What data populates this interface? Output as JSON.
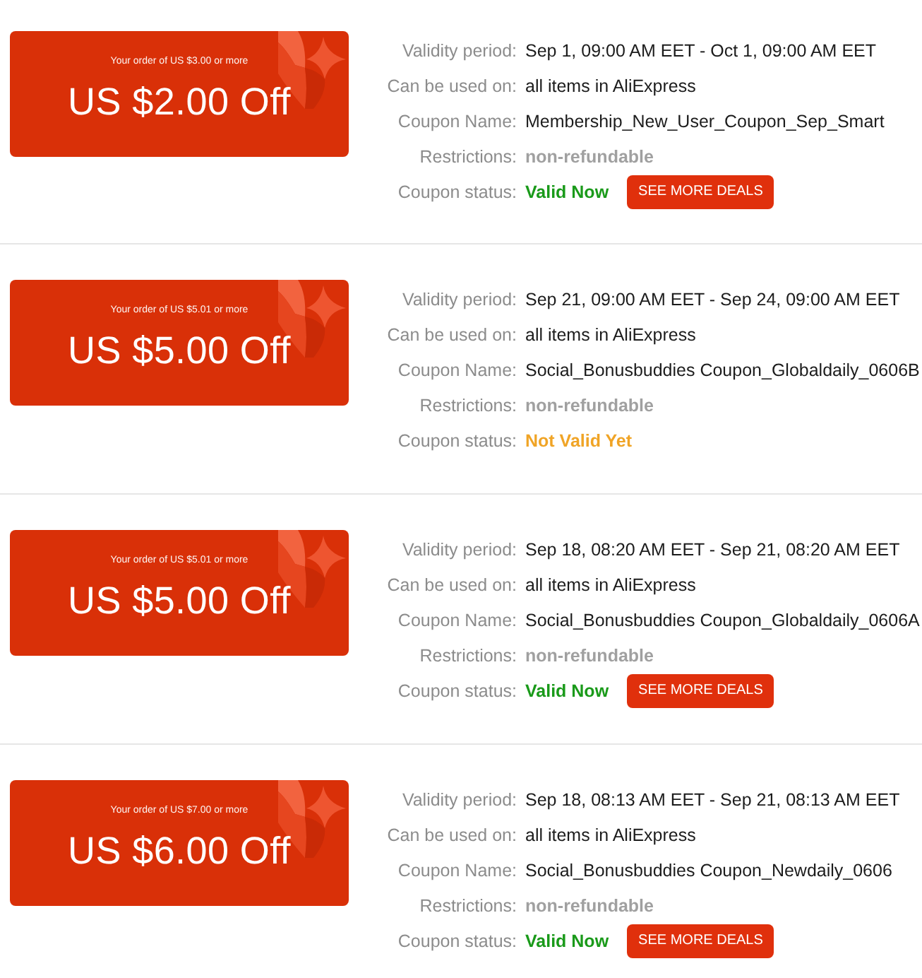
{
  "coupons": [
    {
      "card": {
        "condition": "Your order of US $3.00 or more",
        "amount": "US $2.00 Off"
      },
      "details": [
        {
          "label": "Validity period:",
          "value": "Sep 1, 09:00 AM EET - Oct 1, 09:00 AM EET",
          "kind": "plain"
        },
        {
          "label": "Can be used on:",
          "value": "all items in AliExpress",
          "kind": "plain"
        },
        {
          "label": "Coupon Name:",
          "value": "Membership_New_User_Coupon_Sep_Smart",
          "kind": "plain"
        },
        {
          "label": "Restrictions:",
          "value": "non-refundable",
          "kind": "muted"
        },
        {
          "label": "Coupon status:",
          "value": "Valid Now",
          "kind": "valid",
          "button": "SEE MORE DEALS"
        }
      ]
    },
    {
      "card": {
        "condition": "Your order of US $5.01 or more",
        "amount": "US $5.00 Off"
      },
      "details": [
        {
          "label": "Validity period:",
          "value": "Sep 21, 09:00 AM EET - Sep 24, 09:00 AM EET",
          "kind": "plain"
        },
        {
          "label": "Can be used on:",
          "value": "all items in AliExpress",
          "kind": "plain"
        },
        {
          "label": "Coupon Name:",
          "value": "Social_Bonusbuddies Coupon_Globaldaily_0606B",
          "kind": "plain"
        },
        {
          "label": "Restrictions:",
          "value": "non-refundable",
          "kind": "muted"
        },
        {
          "label": "Coupon status:",
          "value": "Not Valid Yet",
          "kind": "pending"
        }
      ]
    },
    {
      "card": {
        "condition": "Your order of US $5.01 or more",
        "amount": "US $5.00 Off"
      },
      "details": [
        {
          "label": "Validity period:",
          "value": "Sep 18, 08:20 AM EET - Sep 21, 08:20 AM EET",
          "kind": "plain"
        },
        {
          "label": "Can be used on:",
          "value": "all items in AliExpress",
          "kind": "plain"
        },
        {
          "label": "Coupon Name:",
          "value": "Social_Bonusbuddies Coupon_Globaldaily_0606A",
          "kind": "plain"
        },
        {
          "label": "Restrictions:",
          "value": "non-refundable",
          "kind": "muted"
        },
        {
          "label": "Coupon status:",
          "value": "Valid Now",
          "kind": "valid",
          "button": "SEE MORE DEALS"
        }
      ]
    },
    {
      "card": {
        "condition": "Your order of US $7.00 or more",
        "amount": "US $6.00 Off"
      },
      "details": [
        {
          "label": "Validity period:",
          "value": "Sep 18, 08:13 AM EET - Sep 21, 08:13 AM EET",
          "kind": "plain"
        },
        {
          "label": "Can be used on:",
          "value": "all items in AliExpress",
          "kind": "plain"
        },
        {
          "label": "Coupon Name:",
          "value": "Social_Bonusbuddies Coupon_Newdaily_0606",
          "kind": "plain"
        },
        {
          "label": "Restrictions:",
          "value": "non-refundable",
          "kind": "muted"
        },
        {
          "label": "Coupon status:",
          "value": "Valid Now",
          "kind": "valid",
          "button": "SEE MORE DEALS"
        }
      ]
    }
  ]
}
